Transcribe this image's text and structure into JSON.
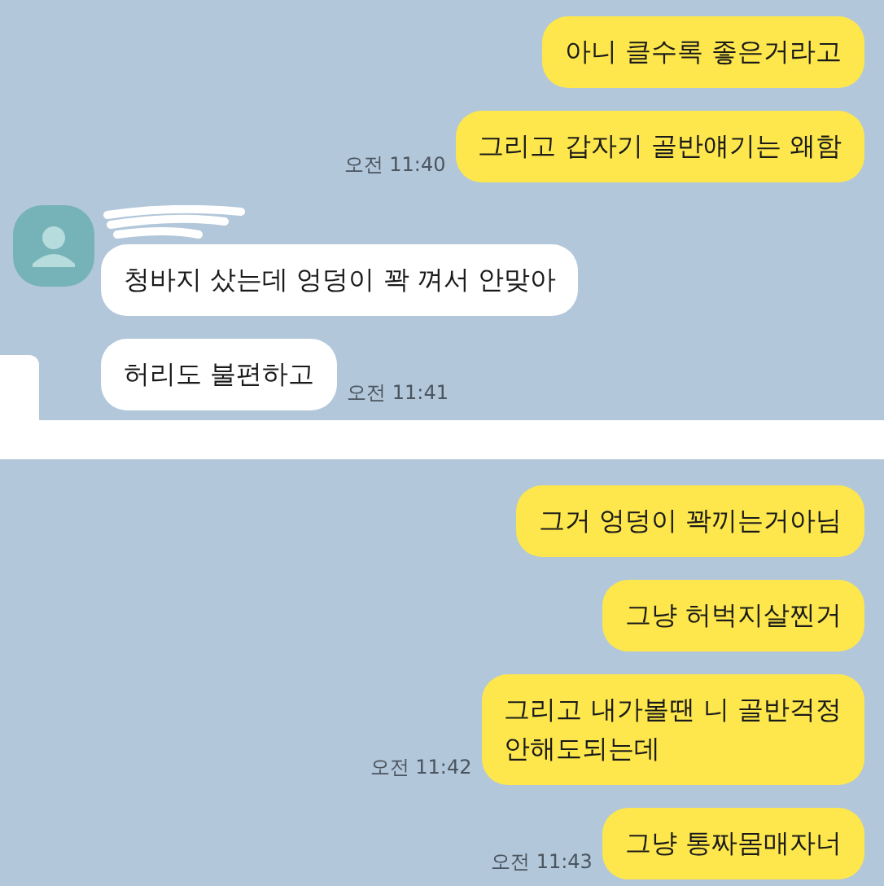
{
  "panels": [
    {
      "side_tab": true,
      "messages": [
        {
          "kind": "sent",
          "text": "아니 클수록 좋은거라고"
        },
        {
          "kind": "sent",
          "text": "그리고 갑자기 골반얘기는 왜함",
          "time": "오전 11:40"
        },
        {
          "kind": "received",
          "first": true,
          "text": "청바지 샀는데 엉덩이 꽉 껴서 안맞아"
        },
        {
          "kind": "received",
          "first": false,
          "text": "허리도 불편하고",
          "time": "오전 11:41"
        }
      ]
    },
    {
      "side_tab": false,
      "messages": [
        {
          "kind": "sent",
          "text": "그거 엉덩이 꽉끼는거아님"
        },
        {
          "kind": "sent",
          "text": "그냥 허벅지살찐거"
        },
        {
          "kind": "sent",
          "text": "그리고 내가볼땐 니 골반걱정\n안해도되는데",
          "time": "오전 11:42"
        },
        {
          "kind": "sent",
          "text": "그냥 통짜몸매자너",
          "time": "오전 11:43"
        }
      ]
    }
  ]
}
